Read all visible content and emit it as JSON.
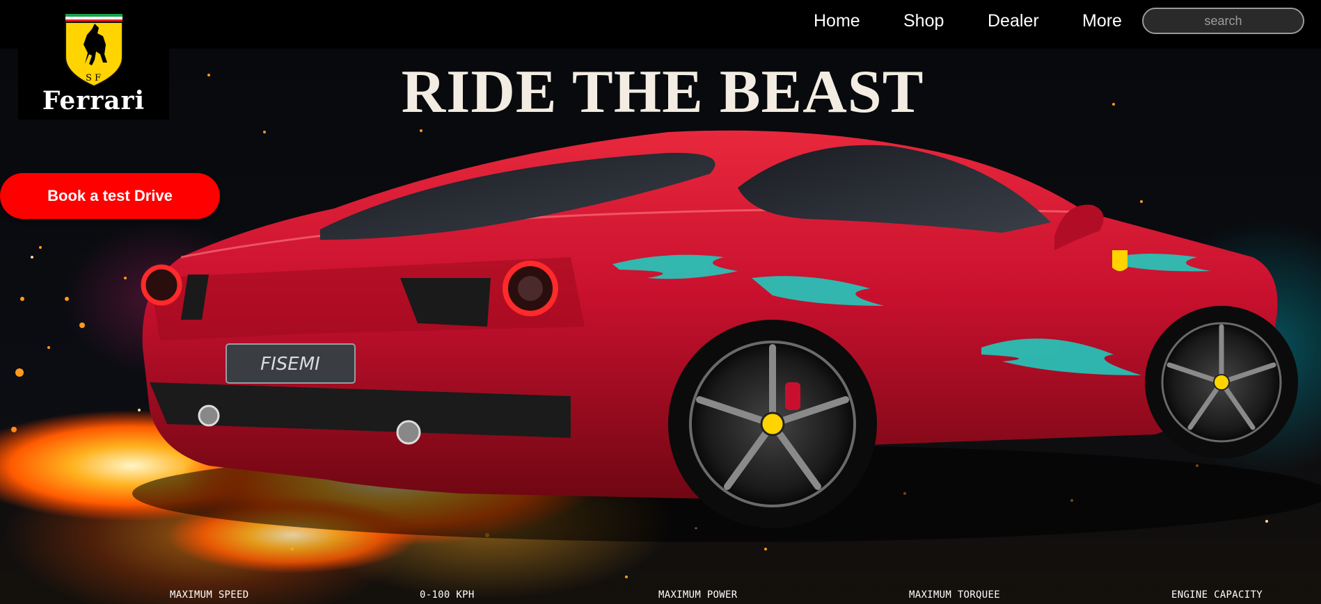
{
  "brand": {
    "name": "Ferrari",
    "badge_initials": "S F"
  },
  "nav": {
    "items": [
      "Home",
      "Shop",
      "Dealer",
      "More"
    ]
  },
  "search": {
    "placeholder": "search"
  },
  "hero": {
    "headline": "RIDE THE BEAST",
    "cta_label": "Book a test Drive",
    "plate_text": "FISEMI"
  },
  "stats": {
    "labels": [
      "MAXIMUM SPEED",
      "0-100 KPH",
      "MAXIMUM POWER",
      "MAXIMUM TORQUEE",
      "ENGINE CAPACITY"
    ]
  },
  "colors": {
    "cta": "#ff0000",
    "headline": "#f3ece2",
    "car_body": "#c8102e",
    "accent_cyan": "#19d3c5",
    "shield_yellow": "#ffd400"
  }
}
